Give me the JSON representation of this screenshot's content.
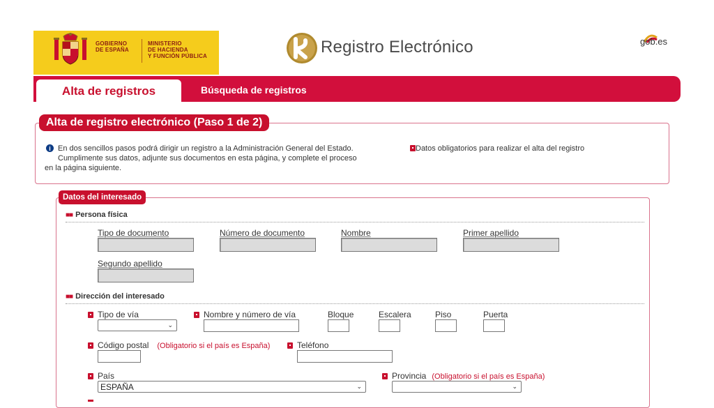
{
  "header": {
    "gov_line1": "GOBIERNO",
    "gov_line2": "DE ESPAÑA",
    "ministry_line1": "MINISTERIO",
    "ministry_line2": "DE HACIENDA",
    "ministry_line3": "Y FUNCIÓN PÚBLICA",
    "app_title": "Registro Electrónico",
    "gob_logo": "gob.es"
  },
  "tabs": [
    {
      "label": "Alta de registros",
      "active": true
    },
    {
      "label": "Búsqueda de registros",
      "active": false
    }
  ],
  "step": {
    "title": "Alta de registro electrónico (Paso 1 de 2)",
    "info_line1": "En dos sencillos pasos podrá dirigir un registro a la Administración General del Estado.",
    "info_line2": "Cumplimente sus datos, adjunte sus documentos en esta página, y complete el proceso",
    "info_line3": "en la página siguiente.",
    "required_note": "Datos obligatorios para realizar el alta del registro"
  },
  "datos": {
    "title": "Datos del interesado",
    "persona": {
      "title": "Persona física",
      "tipo_documento": "Tipo de documento",
      "numero_documento": "Número de documento",
      "nombre": "Nombre",
      "primer_apellido": "Primer apellido",
      "segundo_apellido": "Segundo apellido"
    },
    "direccion": {
      "title": "Dirección del interesado",
      "tipo_via": "Tipo de vía",
      "nombre_numero_via": "Nombre y número de vía",
      "bloque": "Bloque",
      "escalera": "Escalera",
      "piso": "Piso",
      "puerta": "Puerta",
      "codigo_postal": "Código postal",
      "codigo_postal_note": "(Obligatorio si el país es España)",
      "telefono": "Teléfono",
      "pais": "País",
      "pais_value": "ESPAÑA",
      "provincia": "Provincia",
      "provincia_note": "(Obligatorio si el país es España)"
    }
  },
  "colors": {
    "brand_red": "#c8102e",
    "gov_yellow": "#f5cc1c"
  }
}
